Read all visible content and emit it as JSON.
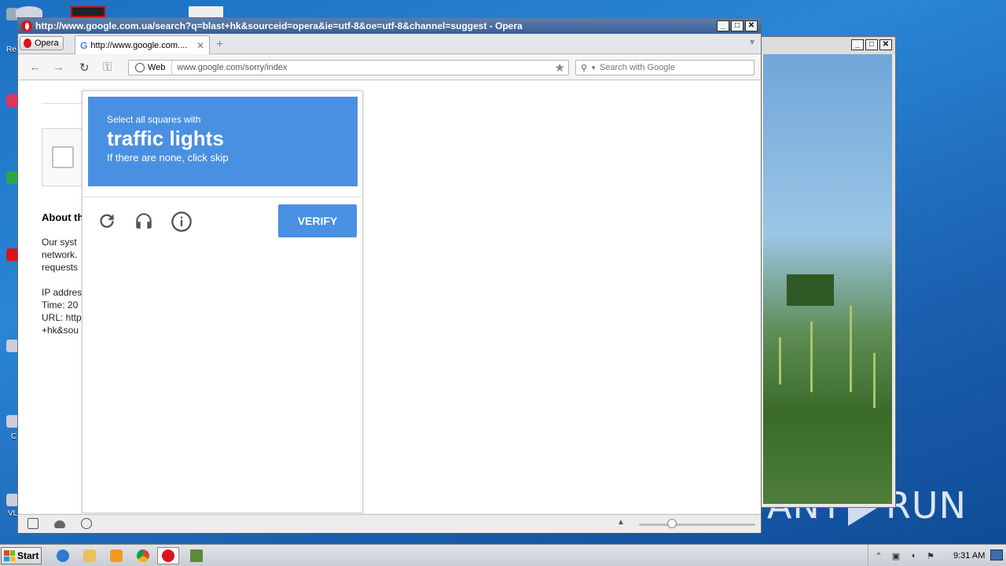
{
  "browser": {
    "window_title": "http://www.google.com.ua/search?q=blast+hk&sourceid=opera&ie=utf-8&oe=utf-8&channel=suggest - Opera",
    "menu_label": "Opera",
    "tab_label": "http://www.google.com....",
    "address_mode": "Web",
    "url": "www.google.com/sorry/index",
    "search_placeholder": "Search with Google"
  },
  "page": {
    "about_heading": "About th",
    "body_lines": [
      "Our syst",
      "network.",
      "requests",
      "",
      "IP addres",
      "Time: 20",
      "URL: http",
      "+hk&sou"
    ]
  },
  "captcha": {
    "instruction_small": "Select all squares with",
    "target": "traffic lights",
    "instruction_sub": "If there are none, click skip",
    "verify_label": "VERIFY"
  },
  "taskbar": {
    "start_label": "Start",
    "clock": "9:31 AM"
  },
  "desktop": {
    "watermark_left": "ANY",
    "watermark_right": "RUN",
    "icon_labels": [
      "Re",
      "C",
      "VL"
    ]
  },
  "colors": {
    "captcha_blue": "#4a90e2",
    "opera_red": "#d8141c",
    "title_bar": "#3a5f92"
  }
}
